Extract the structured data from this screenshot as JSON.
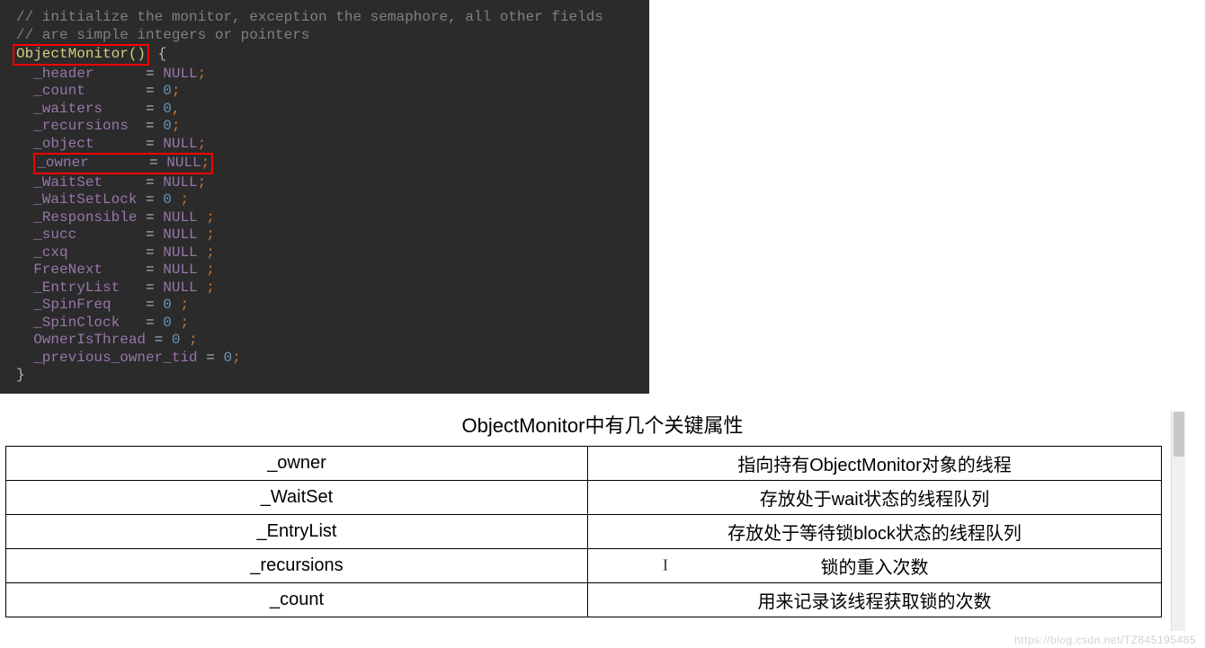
{
  "code": {
    "comment1": "// initialize the monitor, exception the semaphore, all other fields",
    "comment2": "// are simple integers or pointers",
    "func": "ObjectMonitor()",
    "lines": [
      {
        "name": "_header",
        "val": "NULL",
        "term": ";"
      },
      {
        "name": "_count",
        "val": "0",
        "term": ";"
      },
      {
        "name": "_waiters",
        "val": "0",
        "term": ","
      },
      {
        "name": "_recursions",
        "val": "0",
        "term": ";"
      },
      {
        "name": "_object",
        "val": "NULL",
        "term": ";"
      },
      {
        "name": "_owner",
        "val": "NULL",
        "term": ";",
        "boxed": true
      },
      {
        "name": "_WaitSet",
        "val": "NULL",
        "term": ";"
      },
      {
        "name": "_WaitSetLock",
        "val": "0",
        "term": " ;"
      },
      {
        "name": "_Responsible",
        "val": "NULL",
        "term": " ;"
      },
      {
        "name": "_succ",
        "val": "NULL",
        "term": " ;"
      },
      {
        "name": "_cxq",
        "val": "NULL",
        "term": " ;"
      },
      {
        "name": "FreeNext",
        "val": "NULL",
        "term": " ;"
      },
      {
        "name": "_EntryList",
        "val": "NULL",
        "term": " ;"
      },
      {
        "name": "_SpinFreq",
        "val": "0",
        "term": " ;"
      },
      {
        "name": "_SpinClock",
        "val": "0",
        "term": " ;"
      },
      {
        "name": "OwnerIsThread",
        "val": "0",
        "term": " ;"
      },
      {
        "name": "_previous_owner_tid",
        "val": "0",
        "term": ";"
      }
    ]
  },
  "doc": {
    "title": "ObjectMonitor中有几个关键属性",
    "rows": [
      {
        "attr": "_owner",
        "desc": "指向持有ObjectMonitor对象的线程"
      },
      {
        "attr": "_WaitSet",
        "desc": "存放处于wait状态的线程队列"
      },
      {
        "attr": "_EntryList",
        "desc": "存放处于等待锁block状态的线程队列"
      },
      {
        "attr": "_recursions",
        "desc": "锁的重入次数",
        "has_cursor": true
      },
      {
        "attr": "_count",
        "desc": "用来记录该线程获取锁的次数"
      }
    ]
  },
  "watermark": "https://blog.csdn.net/TZ845195485"
}
